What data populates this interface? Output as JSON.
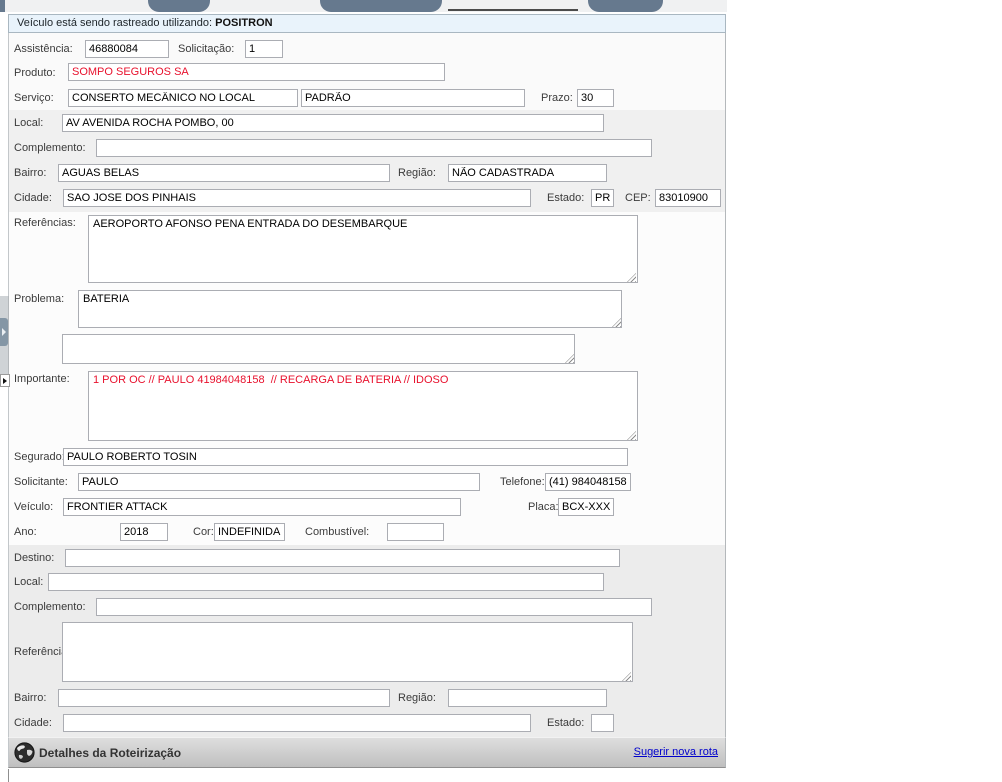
{
  "banner": {
    "prefix": "Veículo está sendo rastreado utilizando:",
    "tracker": "POSITRON"
  },
  "form": {
    "assistencia": {
      "label": "Assistência:",
      "value": "46880084"
    },
    "solicitacao": {
      "label": "Solicitação:",
      "value": "1"
    },
    "produto": {
      "label": "Produto:",
      "value": "SOMPO SEGUROS SA"
    },
    "servico": {
      "label": "Serviço:",
      "value": "CONSERTO MECÂNICO NO LOCAL",
      "value2": "PADRÃO"
    },
    "prazo": {
      "label": "Prazo:",
      "value": "30"
    },
    "local": {
      "label": "Local:",
      "value": "AV AVENIDA ROCHA POMBO, 00"
    },
    "complemento": {
      "label": "Complemento:",
      "value": ""
    },
    "bairro": {
      "label": "Bairro:",
      "value": "AGUAS BELAS"
    },
    "regiao": {
      "label": "Região:",
      "value": "NÃO CADASTRADA"
    },
    "cidade": {
      "label": "Cidade:",
      "value": "SAO JOSE DOS PINHAIS"
    },
    "estado": {
      "label": "Estado:",
      "value": "PR"
    },
    "cep": {
      "label": "CEP:",
      "value": "83010900"
    },
    "referencias": {
      "label": "Referências:",
      "value": "AEROPORTO AFONSO PENA ENTRADA DO DESEMBARQUE"
    },
    "problema": {
      "label": "Problema:",
      "value": "BATERIA"
    },
    "extra": {
      "value": ""
    },
    "importante": {
      "label": "Importante:",
      "value": "1 POR OC // PAULO 41984048158  // RECARGA DE BATERIA // IDOSO"
    },
    "segurado": {
      "label": "Segurado:",
      "value": "PAULO ROBERTO TOSIN"
    },
    "solicitante": {
      "label": "Solicitante:",
      "value": "PAULO"
    },
    "telefone": {
      "label": "Telefone:",
      "value": "(41) 984048158"
    },
    "veiculo": {
      "label": "Veículo:",
      "value": "FRONTIER ATTACK"
    },
    "placa": {
      "label": "Placa:",
      "value": "BCX-XXXX"
    },
    "ano": {
      "label": "Ano:",
      "value": "2018"
    },
    "cor": {
      "label": "Cor:",
      "value": "INDEFINIDA"
    },
    "combustivel": {
      "label": "Combustível:",
      "value": ""
    }
  },
  "destino": {
    "destino": {
      "label": "Destino:",
      "value": ""
    },
    "local": {
      "label": "Local:",
      "value": ""
    },
    "complemento": {
      "label": "Complemento:",
      "value": ""
    },
    "referencia": {
      "label": "Referência:",
      "value": ""
    },
    "bairro": {
      "label": "Bairro:",
      "value": ""
    },
    "regiao": {
      "label": "Região:",
      "value": ""
    },
    "cidade": {
      "label": "Cidade:",
      "value": ""
    },
    "estado": {
      "label": "Estado:",
      "value": ""
    }
  },
  "footer": {
    "title": "Detalhes da Roteirização",
    "link": "Sugerir nova rota",
    "globe_icon": "globe-icon"
  },
  "colors": {
    "alert_text": "#e8112d",
    "banner_bg": "#e9f3fb",
    "button_slate": "#66798e",
    "link_blue": "#0000cc"
  }
}
